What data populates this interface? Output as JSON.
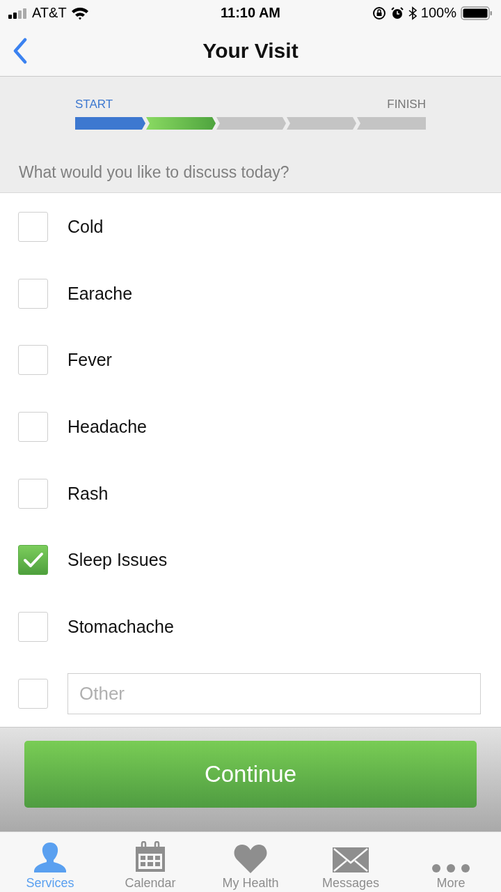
{
  "status_bar": {
    "carrier": "AT&T",
    "time": "11:10 AM",
    "battery": "100%"
  },
  "nav": {
    "title": "Your Visit"
  },
  "progress": {
    "start_label": "START",
    "finish_label": "FINISH",
    "steps": [
      {
        "kind": "done"
      },
      {
        "kind": "current"
      },
      {
        "kind": "todo"
      },
      {
        "kind": "todo"
      },
      {
        "kind": "todo"
      }
    ]
  },
  "question": "What would you like to discuss today?",
  "options": [
    {
      "label": "Cold",
      "checked": false
    },
    {
      "label": "Earache",
      "checked": false
    },
    {
      "label": "Fever",
      "checked": false
    },
    {
      "label": "Headache",
      "checked": false
    },
    {
      "label": "Rash",
      "checked": false
    },
    {
      "label": "Sleep Issues",
      "checked": true
    },
    {
      "label": "Stomachache",
      "checked": false
    }
  ],
  "other": {
    "checked": false,
    "placeholder": "Other"
  },
  "continue_button": "Continue",
  "tabs": [
    {
      "label": "Services",
      "selected": true,
      "kind": "person"
    },
    {
      "label": "Calendar",
      "selected": false,
      "kind": "calendar"
    },
    {
      "label": "My Health",
      "selected": false,
      "kind": "heart"
    },
    {
      "label": "Messages",
      "selected": false,
      "kind": "envelope"
    },
    {
      "label": "More",
      "selected": false,
      "kind": "more"
    }
  ]
}
